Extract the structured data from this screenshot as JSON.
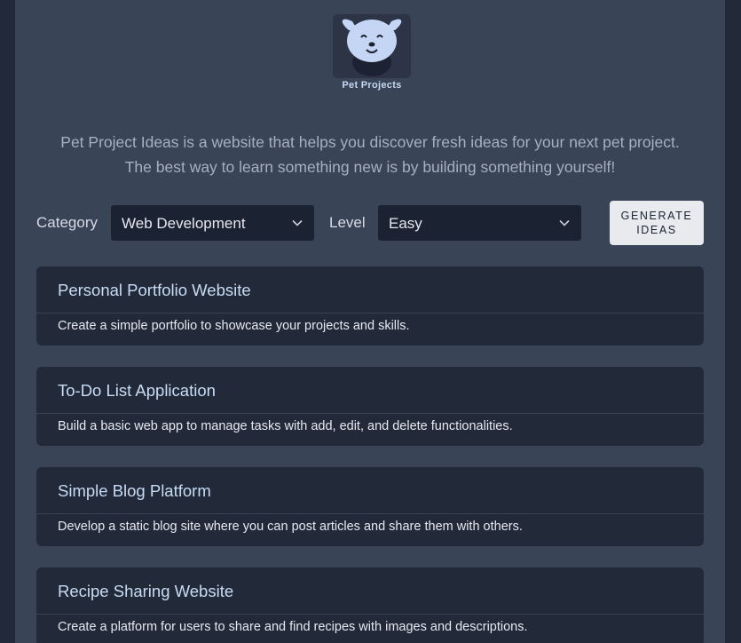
{
  "logo": {
    "text": "Pet Projects",
    "icon": "dog-cat-logo-icon"
  },
  "intro": {
    "line1": "Pet Project Ideas is a website that helps you discover fresh ideas for your next pet project.",
    "line2": "The best way to learn something new is by building something yourself!"
  },
  "controls": {
    "category_label": "Category",
    "category_value": "Web Development",
    "level_label": "Level",
    "level_value": "Easy",
    "generate_line1": "GENERATE",
    "generate_line2": "IDEAS"
  },
  "ideas": [
    {
      "title": "Personal Portfolio Website",
      "description": "Create a simple portfolio to showcase your projects and skills."
    },
    {
      "title": "To-Do List Application",
      "description": "Build a basic web app to manage tasks with add, edit, and delete functionalities."
    },
    {
      "title": "Simple Blog Platform",
      "description": "Develop a static blog site where you can post articles and share them with others."
    },
    {
      "title": "Recipe Sharing Website",
      "description": "Create a platform for users to share and find recipes with images and descriptions."
    }
  ],
  "colors": {
    "page_bg": "#3a4457",
    "outer_bg": "#222a3a",
    "card_bg": "#222a3a",
    "select_bg": "#1b2232",
    "button_bg": "#e8eaee",
    "title_color": "#c8dcf5"
  }
}
